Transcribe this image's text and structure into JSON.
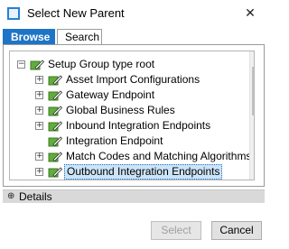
{
  "window": {
    "title": "Select New Parent",
    "close_glyph": "✕",
    "icon": "dialog-icon"
  },
  "tabs": [
    {
      "label": "Browse",
      "active": true
    },
    {
      "label": "Search",
      "active": false
    }
  ],
  "tree": {
    "root": {
      "label": "Setup Group type root",
      "expander": "−",
      "expanded": true
    },
    "children": [
      {
        "label": "Asset Import Configurations",
        "expander": "+",
        "has_children": true,
        "selected": false
      },
      {
        "label": "Gateway Endpoint",
        "expander": "+",
        "has_children": true,
        "selected": false
      },
      {
        "label": "Global Business Rules",
        "expander": "+",
        "has_children": true,
        "selected": false
      },
      {
        "label": "Inbound Integration Endpoints",
        "expander": "+",
        "has_children": true,
        "selected": false
      },
      {
        "label": "Integration Endpoint",
        "expander": "",
        "has_children": false,
        "selected": false
      },
      {
        "label": "Match Codes and Matching Algorithms",
        "expander": "+",
        "has_children": true,
        "selected": false
      },
      {
        "label": "Outbound Integration Endpoints",
        "expander": "+",
        "has_children": true,
        "selected": true
      }
    ],
    "scroll_up_glyph": "▲",
    "scroll_down_glyph": "▼"
  },
  "details": {
    "label": "Details",
    "icon_glyph": "⊕"
  },
  "buttons": {
    "select": "Select",
    "select_enabled": false,
    "cancel": "Cancel"
  },
  "colors": {
    "accent": "#1e74c6",
    "selection": "#cce4f7",
    "icon_green": "#5fae3a"
  }
}
